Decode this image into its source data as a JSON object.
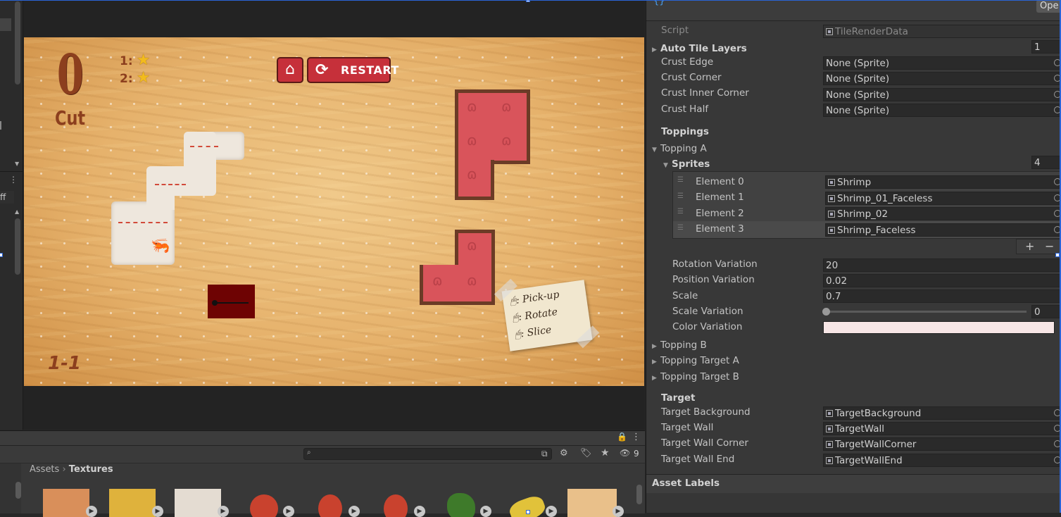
{
  "game": {
    "cut_count": "0",
    "cut_label": "Cut",
    "star_rows": [
      {
        "label": "1:"
      },
      {
        "label": "2:"
      }
    ],
    "restart_label": "RESTART",
    "level": "1-1",
    "note": {
      "line1": ": Pick-up",
      "line2": ": Rotate",
      "line3": ": Slice"
    }
  },
  "inspector": {
    "open_label": "Ope",
    "script": {
      "label": "Script",
      "value": "TileRenderData"
    },
    "auto_tile_layers": {
      "label": "Auto Tile Layers",
      "value": "1"
    },
    "crust": [
      {
        "label": "Crust Edge",
        "value": "None (Sprite)"
      },
      {
        "label": "Crust Corner",
        "value": "None (Sprite)"
      },
      {
        "label": "Crust Inner Corner",
        "value": "None (Sprite)"
      },
      {
        "label": "Crust Half",
        "value": "None (Sprite)"
      }
    ],
    "toppings_header": "Toppings",
    "topping_a": "Topping A",
    "sprites": {
      "label": "Sprites",
      "count": "4"
    },
    "elements": [
      {
        "label": "Element 0",
        "value": "Shrimp"
      },
      {
        "label": "Element 1",
        "value": "Shrimp_01_Faceless"
      },
      {
        "label": "Element 2",
        "value": "Shrimp_02"
      },
      {
        "label": "Element 3",
        "value": "Shrimp_Faceless"
      }
    ],
    "add_symbol": "+",
    "remove_symbol": "−",
    "rotation_variation": {
      "label": "Rotation Variation",
      "value": "20"
    },
    "position_variation": {
      "label": "Position Variation",
      "value": "0.02"
    },
    "scale": {
      "label": "Scale",
      "value": "0.7"
    },
    "scale_variation": {
      "label": "Scale Variation",
      "value": "0",
      "level": 0
    },
    "color_variation": {
      "label": "Color Variation",
      "color": "#f7e6e6"
    },
    "collapsed": [
      "Topping B",
      "Topping Target A",
      "Topping Target B"
    ],
    "target_header": "Target",
    "targets": [
      {
        "label": "Target Background",
        "value": "TargetBackground"
      },
      {
        "label": "Target Wall",
        "value": "TargetWall"
      },
      {
        "label": "Target Wall Corner",
        "value": "TargetWallCorner"
      },
      {
        "label": "Target Wall End",
        "value": "TargetWallEnd"
      }
    ],
    "asset_labels": "Asset Labels"
  },
  "project": {
    "breadcrumb_root": "Assets",
    "breadcrumb_current": "Textures",
    "hidden_count": "9",
    "left_partial": "ff"
  },
  "colors": {
    "panel_bg": "#383838",
    "field_bg": "#2a2a2a",
    "restart_red": "#c6303a",
    "tile_red": "#d9545b",
    "wall_brown": "#6b3b26"
  }
}
